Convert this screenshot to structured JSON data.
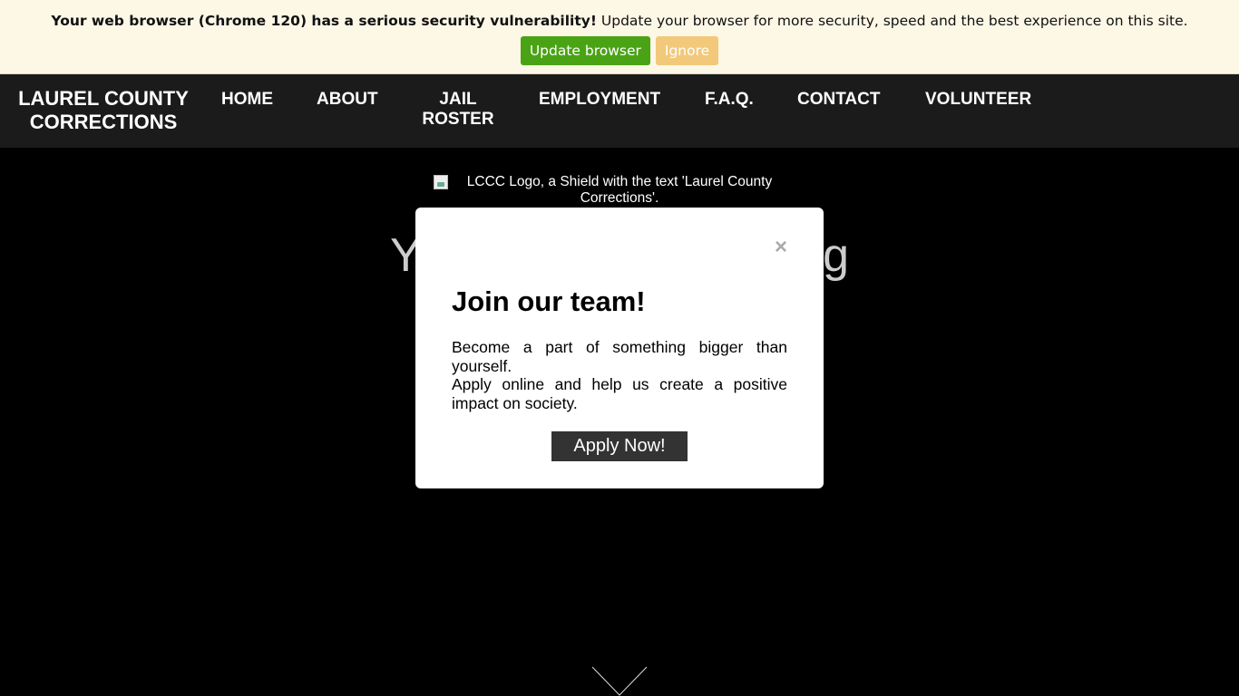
{
  "update_banner": {
    "bold_text": "Your web browser (Chrome 120) has a serious security vulnerability!",
    "text": " Update your browser for more security, speed and the best experience on this site.",
    "update_label": "Update browser",
    "ignore_label": "Ignore",
    "update_color": "#4aa315",
    "ignore_color": "#f2c97a"
  },
  "navbar": {
    "brand_line1": "LAUREL COUNTY",
    "brand_line2": "CORRECTIONS",
    "items": [
      {
        "label": "HOME"
      },
      {
        "label": "ABOUT"
      },
      {
        "label_line1": "JAIL",
        "label_line2": "ROSTER"
      },
      {
        "label": "EMPLOYMENT"
      },
      {
        "label": "F.A.Q."
      },
      {
        "label": "CONTACT"
      },
      {
        "label": "VOLUNTEER"
      }
    ]
  },
  "hero": {
    "logo_alt": "LCCC Logo, a Shield with the text 'Laurel County Corrections'.",
    "heading_visible_left": "Y",
    "heading_visible_right": "g",
    "scroll_icon": "chevron-down-icon"
  },
  "modal": {
    "close_label": "×",
    "title": "Join our team!",
    "line1": "Become a part of something bigger than yourself.",
    "line2": "Apply online and help us create a positive impact on society.",
    "apply_label": "Apply Now!"
  }
}
